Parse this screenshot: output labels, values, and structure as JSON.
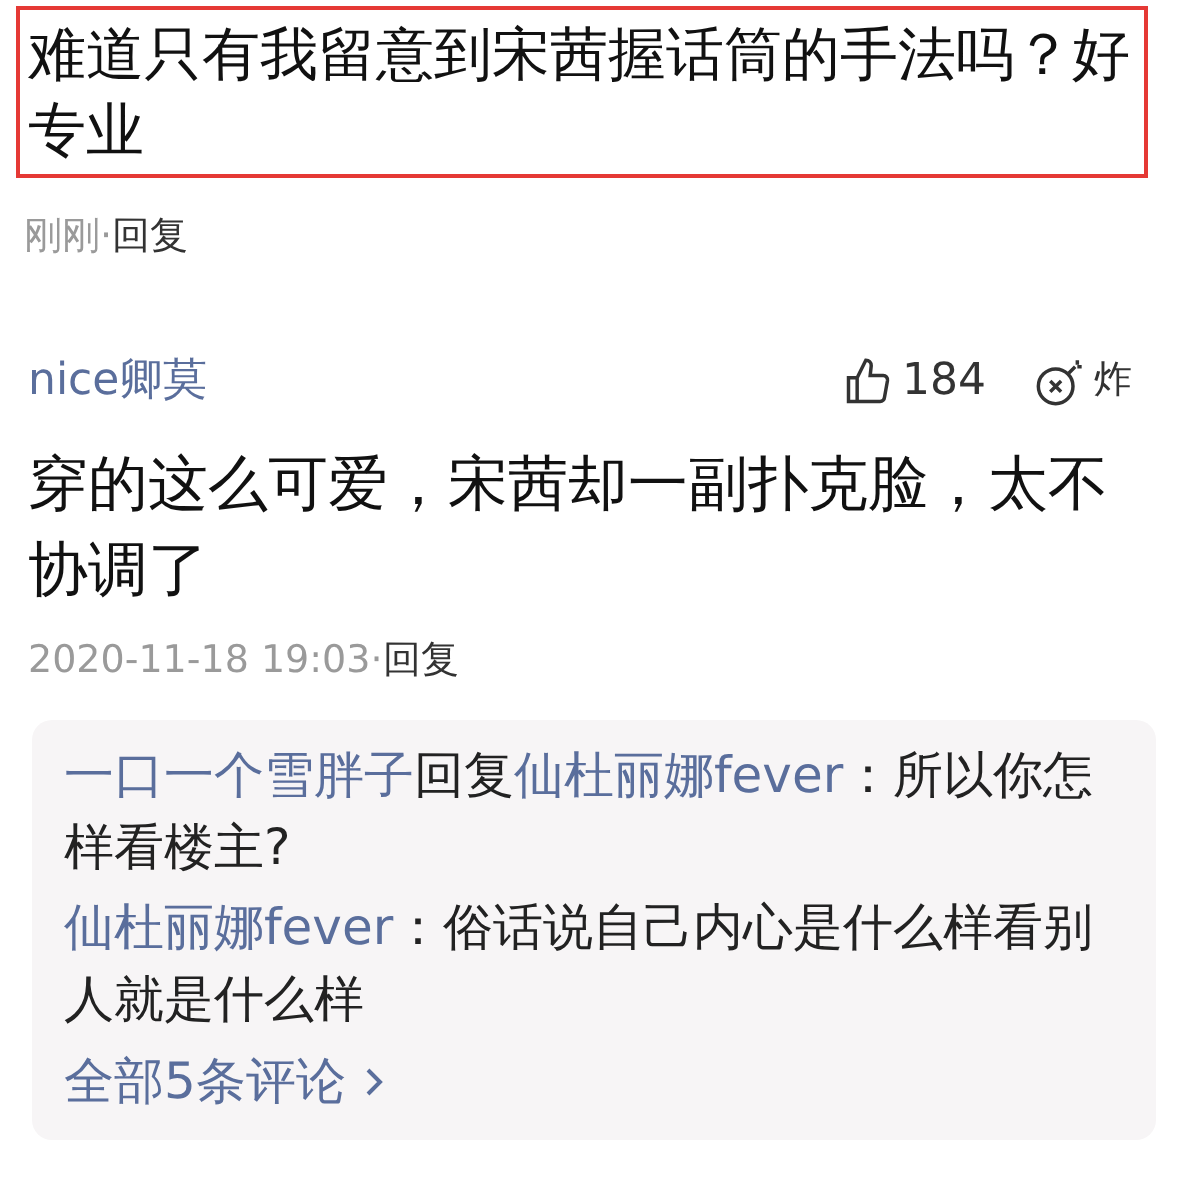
{
  "comments": [
    {
      "text": "难道只有我留意到宋茜握话筒的手法吗？好专业",
      "highlighted": true,
      "time": "刚刚",
      "separator": "·",
      "reply_action": "回复"
    },
    {
      "username": "nice卿莫",
      "likes": "184",
      "dislike_label": "炸",
      "text": "穿的这么可爱，宋茜却一副扑克脸，太不协调了",
      "highlighted": false,
      "time": "2020-11-18 19:03",
      "separator": "·",
      "reply_action": "回复",
      "replies": [
        {
          "user": "一口一个雪胖子",
          "verb": "回复",
          "target": "仙杜丽娜fever",
          "text": "：所以你怎样看楼主?"
        },
        {
          "user": "仙杜丽娜fever",
          "text": "：俗话说自己内心是什么样看别人就是什么样"
        }
      ],
      "more_replies": "全部5条评论"
    }
  ]
}
